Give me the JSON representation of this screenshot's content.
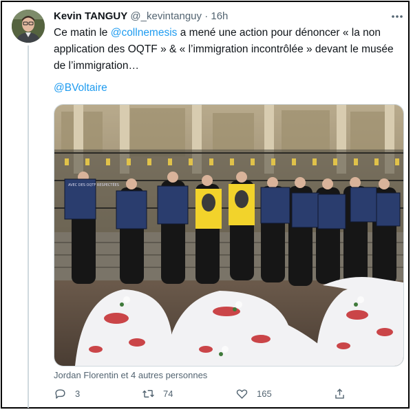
{
  "tweet": {
    "author_name": "Kevin TANGUY",
    "author_handle": "@_kevintanguy",
    "separator": "·",
    "time": "16h",
    "text_prefix": "Ce matin le ",
    "mention": "@collnemesis",
    "text_rest": " a mené une action pour dénoncer « la non application des OQTF » & « l’immigration incontrôlée » devant le musée de l’immigration…",
    "tag": "@BVoltaire",
    "likers": "Jordan Florentin et 4 autres personnes"
  },
  "actions": {
    "reply_count": "3",
    "retweet_count": "74",
    "like_count": "165"
  },
  "photo": {
    "sign_text": "AVEC DES OQTF RESPECTÉES"
  },
  "icons": {
    "more": "more-dots-icon",
    "reply": "reply-bubble-icon",
    "retweet": "retweet-icon",
    "like": "heart-icon",
    "share": "share-upload-icon"
  },
  "colors": {
    "link": "#1d9bf0",
    "muted": "#536471",
    "text": "#0f1419"
  }
}
